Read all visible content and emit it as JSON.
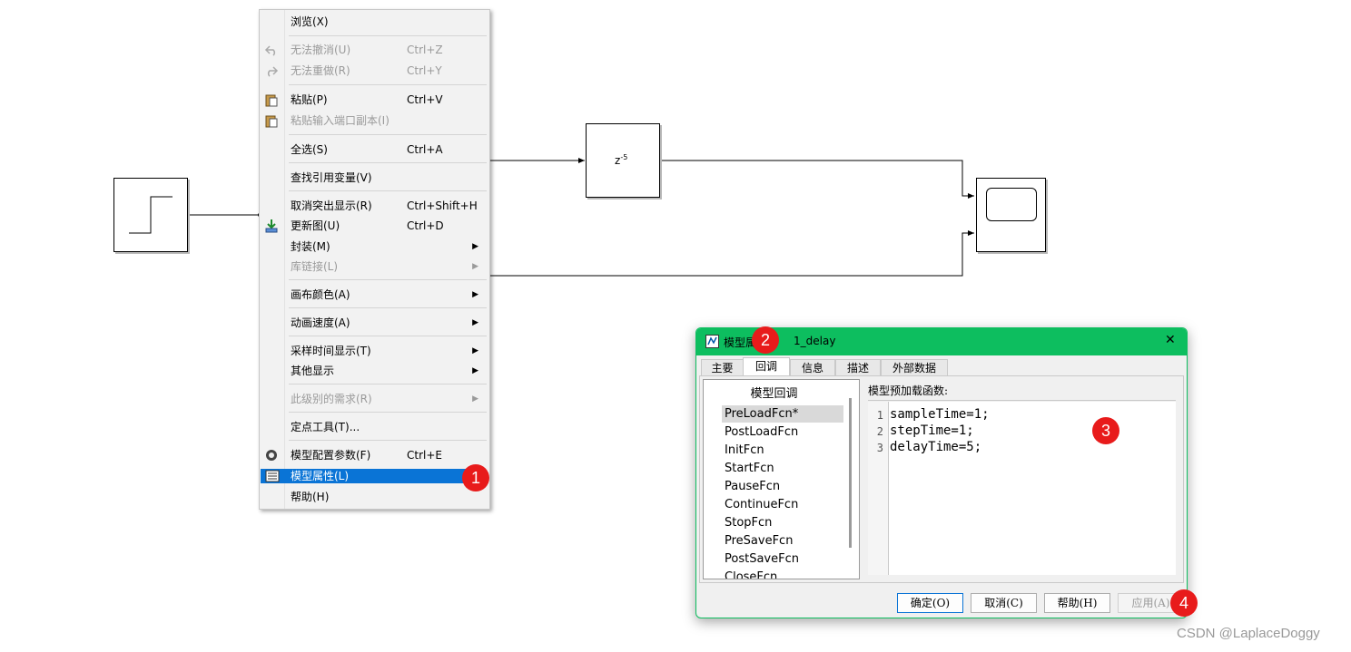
{
  "context_menu": {
    "items": [
      {
        "label": "浏览(X)",
        "shortcut": "",
        "icon": "",
        "disabled": false,
        "submenu": false
      },
      {
        "label": "无法撤消(U)",
        "shortcut": "Ctrl+Z",
        "icon": "undo-icon",
        "disabled": true,
        "submenu": false
      },
      {
        "label": "无法重做(R)",
        "shortcut": "Ctrl+Y",
        "icon": "redo-icon",
        "disabled": true,
        "submenu": false
      },
      {
        "label": "粘贴(P)",
        "shortcut": "Ctrl+V",
        "icon": "paste-icon",
        "disabled": false,
        "submenu": false
      },
      {
        "label": "粘贴输入端口副本(I)",
        "shortcut": "",
        "icon": "paste-icon",
        "disabled": true,
        "submenu": false
      },
      {
        "label": "全选(S)",
        "shortcut": "Ctrl+A",
        "icon": "",
        "disabled": false,
        "submenu": false
      },
      {
        "label": "查找引用变量(V)",
        "shortcut": "",
        "icon": "",
        "disabled": false,
        "submenu": false
      },
      {
        "label": "取消突出显示(R)",
        "shortcut": "Ctrl+Shift+H",
        "icon": "",
        "disabled": false,
        "submenu": false
      },
      {
        "label": "更新图(U)",
        "shortcut": "Ctrl+D",
        "icon": "update-diagram-icon",
        "disabled": false,
        "submenu": false
      },
      {
        "label": "封装(M)",
        "shortcut": "",
        "icon": "",
        "disabled": false,
        "submenu": true
      },
      {
        "label": "库链接(L)",
        "shortcut": "",
        "icon": "",
        "disabled": true,
        "submenu": true
      },
      {
        "label": "画布颜色(A)",
        "shortcut": "",
        "icon": "",
        "disabled": false,
        "submenu": true
      },
      {
        "label": "动画速度(A)",
        "shortcut": "",
        "icon": "",
        "disabled": false,
        "submenu": true
      },
      {
        "label": "采样时间显示(T)",
        "shortcut": "",
        "icon": "",
        "disabled": false,
        "submenu": true
      },
      {
        "label": "其他显示",
        "shortcut": "",
        "icon": "",
        "disabled": false,
        "submenu": true
      },
      {
        "label": "此级别的需求(R)",
        "shortcut": "",
        "icon": "",
        "disabled": true,
        "submenu": true
      },
      {
        "label": "定点工具(T)...",
        "shortcut": "",
        "icon": "",
        "disabled": false,
        "submenu": false
      },
      {
        "label": "模型配置参数(F)",
        "shortcut": "Ctrl+E",
        "icon": "gear-icon",
        "disabled": false,
        "submenu": false
      },
      {
        "label": "模型属性(L)",
        "shortcut": "",
        "icon": "properties-icon",
        "disabled": false,
        "submenu": false,
        "highlighted": true
      },
      {
        "label": "帮助(H)",
        "shortcut": "",
        "icon": "",
        "disabled": false,
        "submenu": false
      }
    ]
  },
  "diagram": {
    "delay_block_text": "z",
    "delay_block_exponent": "-5"
  },
  "dialog": {
    "title_prefix": "模型属",
    "title_suffix": "1_delay",
    "close_glyph": "✕",
    "tabs": [
      "主要",
      "回调",
      "信息",
      "描述",
      "外部数据"
    ],
    "active_tab": "回调",
    "callbacks_header": "模型回调",
    "callbacks": [
      "PreLoadFcn*",
      "PostLoadFcn",
      "InitFcn",
      "StartFcn",
      "PauseFcn",
      "ContinueFcn",
      "StopFcn",
      "PreSaveFcn",
      "PostSaveFcn",
      "CloseFcn"
    ],
    "selected_callback": "PreLoadFcn*",
    "editor_label": "模型预加载函数:",
    "code_lines": [
      {
        "num": "1",
        "text": "sampleTime=1;"
      },
      {
        "num": "2",
        "text": "stepTime=1;"
      },
      {
        "num": "3",
        "text": "delayTime=5;"
      }
    ],
    "buttons": {
      "ok": "确定(O)",
      "cancel": "取消(C)",
      "help": "帮助(H)",
      "apply": "应用(A)"
    }
  },
  "badges": [
    "1",
    "2",
    "3",
    "4"
  ],
  "watermark": "CSDN @LaplaceDoggy",
  "colors": {
    "accent": "#0dbe5f",
    "highlight": "#0a74d6",
    "badge": "#e81b1b"
  }
}
